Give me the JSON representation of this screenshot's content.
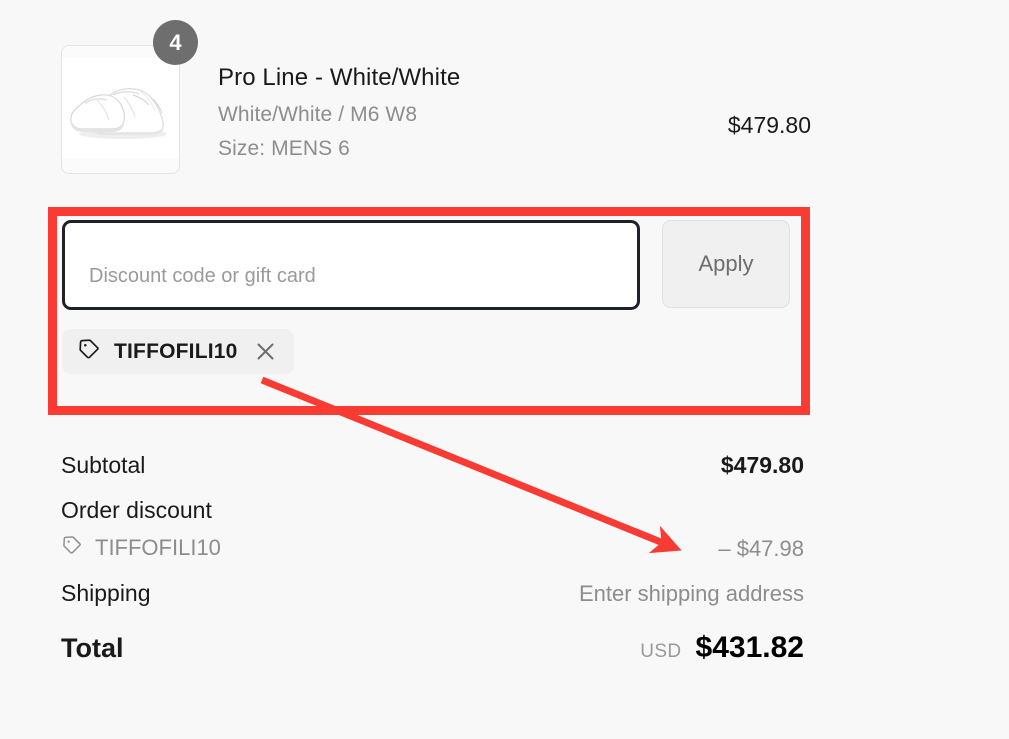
{
  "colors": {
    "background": "#f8f8f8",
    "annotation_red": "#f93b33",
    "input_border": "#1e2128",
    "muted_text": "#8d8d8d",
    "badge_gray": "#6e6e6e",
    "chip_background": "#f0f0f0"
  },
  "product": {
    "quantity_badge": "4",
    "title": "Pro Line - White/White",
    "variant": "White/White / M6 W8",
    "size": "Size: MENS 6",
    "price": "$479.80",
    "thumbnail_icon": "white-slip-on-shoe-image"
  },
  "discount": {
    "input_value": "",
    "input_placeholder": "Discount code or gift card",
    "apply_label": "Apply",
    "applied_chip": {
      "tag_icon": "tag-icon",
      "code": "TIFFOFILI10",
      "remove_icon": "close-x-icon"
    }
  },
  "summary": {
    "subtotal": {
      "label": "Subtotal",
      "value": "$479.80"
    },
    "order_discount": {
      "label": "Order discount",
      "value": ""
    },
    "discount_detail": {
      "tag_icon": "tag-icon",
      "label": "TIFFOFILI10",
      "value": "– $47.98"
    },
    "shipping": {
      "label": "Shipping",
      "value": "Enter shipping address"
    },
    "total": {
      "label": "Total",
      "currency": "USD",
      "amount": "$431.82"
    }
  },
  "annotations": {
    "highlight_box": "red-rectangle-around-discount-section",
    "arrow": "red-arrow-from-discount-chip-to-discount-amount"
  }
}
